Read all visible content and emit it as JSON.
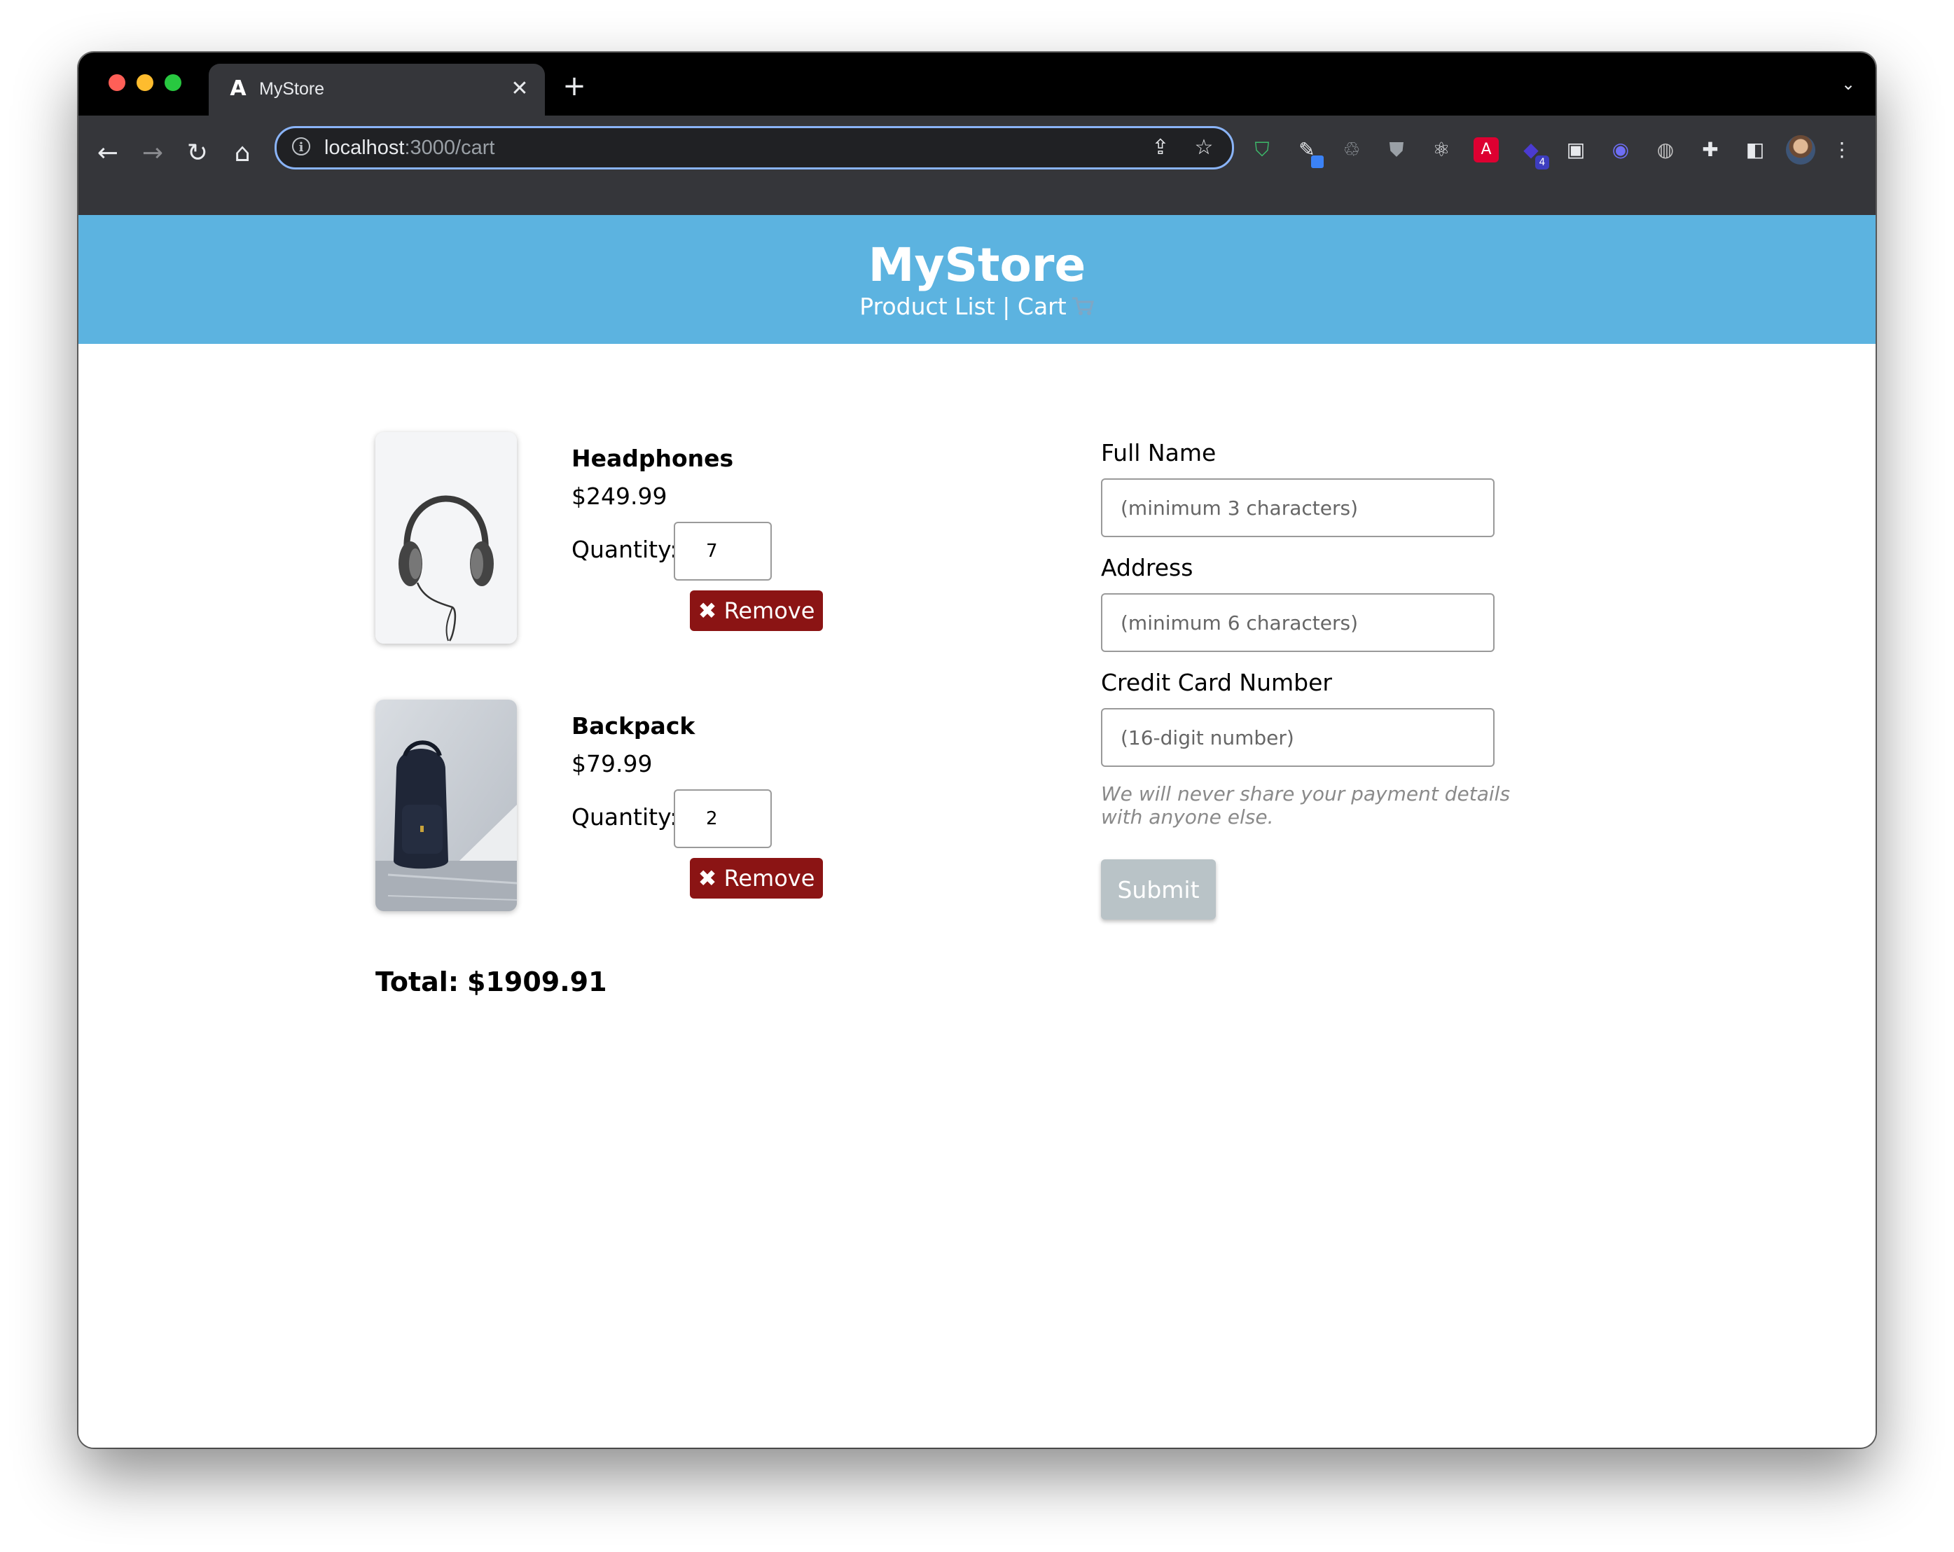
{
  "browser": {
    "tab_title": "MyStore",
    "tab_favicon": "angular-icon",
    "url_host": "localhost",
    "url_path": ":3000/cart",
    "extension_badge": "4"
  },
  "header": {
    "brand": "MyStore",
    "nav_product_list": "Product List",
    "nav_separator": "|",
    "nav_cart": "Cart",
    "background": "#5cb3e0"
  },
  "cart": {
    "items": [
      {
        "name": "Headphones",
        "price": "$249.99",
        "quantity_label": "Quantity:",
        "quantity": "7",
        "remove_label": "Remove",
        "remove_icon": "✖"
      },
      {
        "name": "Backpack",
        "price": "$79.99",
        "quantity_label": "Quantity:",
        "quantity": "2",
        "remove_label": "Remove",
        "remove_icon": "✖"
      }
    ],
    "total_label": "Total:",
    "total_value": "$1909.91"
  },
  "checkout": {
    "full_name_label": "Full Name",
    "full_name_placeholder": "(minimum 3 characters)",
    "full_name_value": "",
    "address_label": "Address",
    "address_placeholder": "(minimum 6 characters)",
    "address_value": "",
    "card_label": "Credit Card Number",
    "card_placeholder": "(16-digit number)",
    "card_value": "",
    "privacy_hint": "We will never share your payment details with anyone else.",
    "submit_label": "Submit"
  },
  "colors": {
    "remove_button": "#8b1414",
    "submit_disabled": "#b9c3c7"
  }
}
